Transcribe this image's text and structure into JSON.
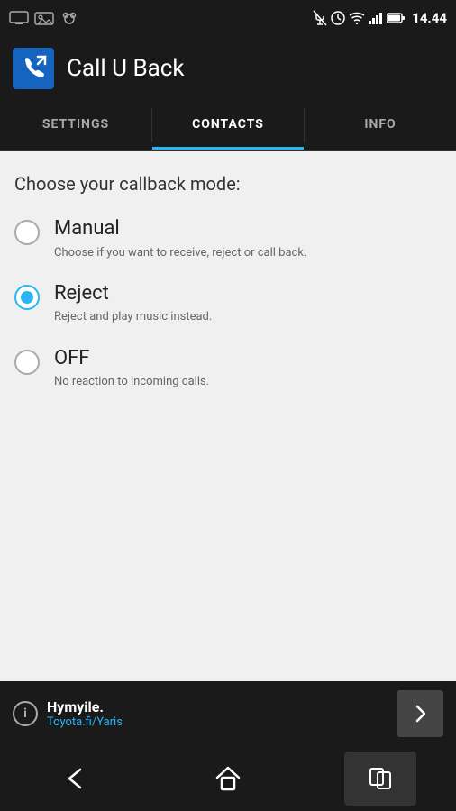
{
  "statusBar": {
    "time": "14.44",
    "icons": [
      "notification",
      "clock",
      "wifi",
      "signal",
      "battery"
    ]
  },
  "appBar": {
    "title": "Call U Back"
  },
  "tabs": [
    {
      "id": "settings",
      "label": "SETTINGS",
      "active": false
    },
    {
      "id": "contacts",
      "label": "CONTACTS",
      "active": true
    },
    {
      "id": "info",
      "label": "INFO",
      "active": false
    }
  ],
  "content": {
    "sectionTitle": "Choose your callback mode:",
    "options": [
      {
        "id": "manual",
        "label": "Manual",
        "description": "Choose if you want to receive, reject or call back.",
        "selected": false
      },
      {
        "id": "reject",
        "label": "Reject",
        "description": "Reject and play music instead.",
        "selected": true
      },
      {
        "id": "off",
        "label": "OFF",
        "description": "No reaction to incoming calls.",
        "selected": false
      }
    ]
  },
  "adBar": {
    "title": "Hymyile.",
    "url": "Toyota.fi/Yaris",
    "arrowLabel": "→"
  },
  "navBar": {
    "back": "back",
    "home": "home",
    "recents": "recents"
  }
}
